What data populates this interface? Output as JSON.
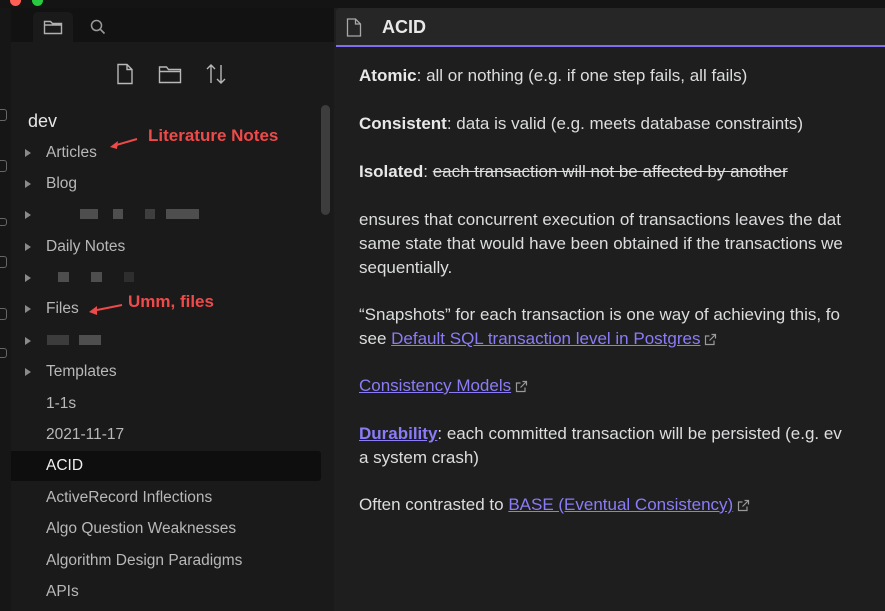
{
  "sidebar": {
    "vault_name": "dev",
    "items": [
      {
        "label": "Articles",
        "folder": true
      },
      {
        "label": "Blog",
        "folder": true
      },
      {
        "label": "",
        "folder": true,
        "blurred": true
      },
      {
        "label": "Daily Notes",
        "folder": true
      },
      {
        "label": "",
        "folder": true,
        "blurred": true
      },
      {
        "label": "Files",
        "folder": true
      },
      {
        "label": "",
        "folder": true,
        "blurred": true
      },
      {
        "label": "Templates",
        "folder": true
      },
      {
        "label": "1-1s",
        "folder": false
      },
      {
        "label": "2021-11-17",
        "folder": false
      },
      {
        "label": "ACID",
        "folder": false,
        "active": true
      },
      {
        "label": "ActiveRecord Inflections",
        "folder": false
      },
      {
        "label": "Algo Question Weaknesses",
        "folder": false
      },
      {
        "label": "Algorithm Design Paradigms",
        "folder": false
      },
      {
        "label": "APIs",
        "folder": false
      }
    ]
  },
  "annotations": {
    "literature": "Literature Notes",
    "files": "Umm, files"
  },
  "editor": {
    "tab_title": "ACID",
    "atomic_term": "Atomic",
    "atomic_text": ": all or nothing (e.g. if one step fails, all fails)",
    "consistent_term": "Consistent",
    "consistent_text": ": data is valid (e.g. meets database constraints)",
    "isolated_term": "Isolated",
    "isolated_colon": ": ",
    "isolated_strike": "each transaction will not be affected by another",
    "ensures_line1": "ensures that concurrent execution of transactions leaves the dat",
    "ensures_line2": "same state that would have been obtained if the transactions we",
    "ensures_line3": "sequentially.",
    "snapshots_line1": "“Snapshots” for each transaction is one way of achieving this, fo",
    "snapshots_see": "see ",
    "snapshots_link": "Default SQL transaction level in Postgres",
    "consistency_link": "Consistency Models",
    "durability_link": "Durability",
    "durability_text": ": each committed transaction will be persisted (e.g. ev",
    "durability_line2": "a system crash)",
    "contrast_text": "Often contrasted to ",
    "contrast_link": "BASE (Eventual Consistency)"
  },
  "colors": {
    "accent": "#7f6df2",
    "link": "#8a7cf7",
    "annotation": "#ef4a4a"
  }
}
